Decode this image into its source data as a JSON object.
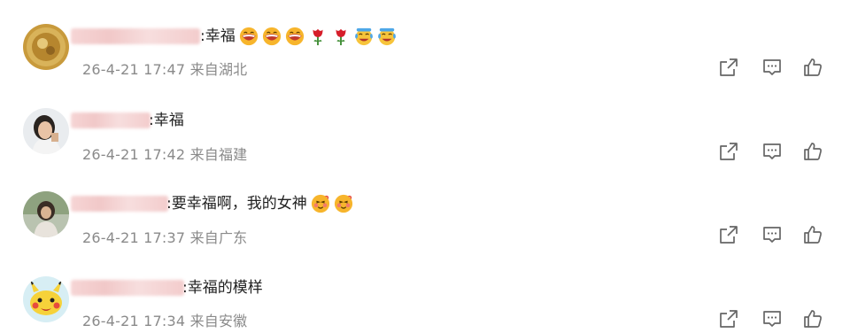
{
  "comments": [
    {
      "colon_text": ":幸福",
      "date": "26-4-21",
      "time": "17:47",
      "location": "来自湖北",
      "emojis": [
        "laugh-emoji",
        "laugh-emoji",
        "laugh-emoji",
        "rose-emoji",
        "rose-emoji",
        "cry-laugh-emoji",
        "cry-laugh-emoji"
      ]
    },
    {
      "colon_text": ":幸福",
      "date": "26-4-21",
      "time": "17:42",
      "location": "来自福建",
      "emojis": []
    },
    {
      "colon_text": ":要幸福啊，我的女神",
      "date": "26-4-21",
      "time": "17:37",
      "location": "来自广东",
      "emojis": [
        "blush-emoji",
        "blush-emoji"
      ]
    },
    {
      "colon_text": ":幸福的模样",
      "date": "26-4-21",
      "time": "17:34",
      "location": "来自安徽",
      "emojis": []
    }
  ],
  "icons": {
    "share": "share-icon",
    "comment": "comment-icon",
    "like": "like-icon"
  },
  "colors": {
    "meta_text": "#8a8a8a",
    "icon": "#666666",
    "name_blur": "#f3cccc"
  }
}
